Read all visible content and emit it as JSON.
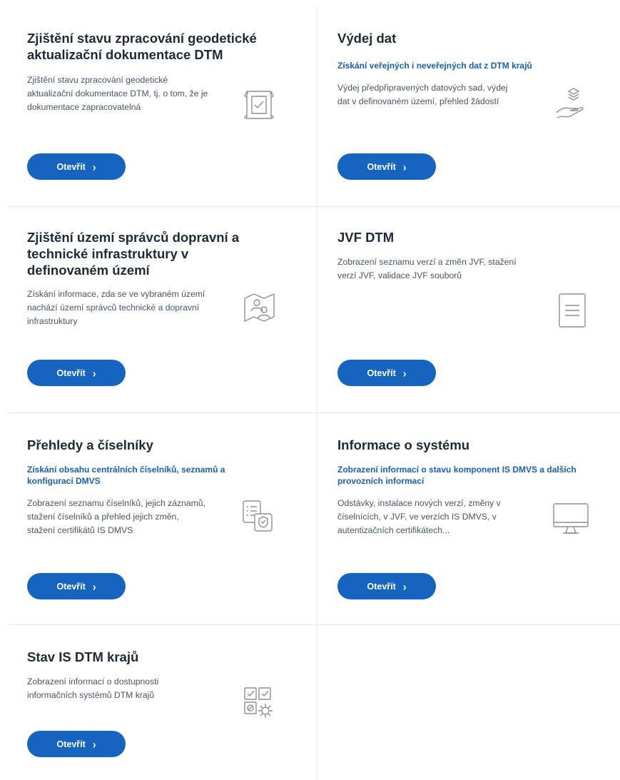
{
  "open_label": "Otevřít",
  "chevron": "›",
  "cards": [
    {
      "title": "Zjištění stavu zpracování geodetické aktualizační dokumentace DTM",
      "subtitle": "",
      "description": "Zjištění stavu zpracování geodetické aktualizační dokumentace DTM, tj. o tom, že je dokumentace zapracovatelná",
      "icon": "document-check-icon"
    },
    {
      "title": "Výdej dat",
      "subtitle": "Získání veřejných i neveřejných dat z DTM krajů",
      "description": "Výdej předpřipravených datových sad, výdej dat v definovaném území, přehled žádostí",
      "icon": "hand-layers-icon"
    },
    {
      "title": "Zjištění území správců dopravní a technické infrastruktury v definovaném území",
      "subtitle": "",
      "description": "Získání informace, zda se ve vybraném území nachází území správců technické a dopravní infrastruktury",
      "icon": "map-people-icon"
    },
    {
      "title": "JVF DTM",
      "subtitle": "",
      "description": "Zobrazení seznamu verzí a změn JVF, stažení verzí JVF, validace JVF souborů",
      "icon": "file-lines-icon"
    },
    {
      "title": "Přehledy a číselníky",
      "subtitle": "Získání obsahu centrálních číselníků, seznamů a konfigurací DMVS",
      "description": "Zobrazení seznamu číselníků, jejich záznamů, stažení číselníků a přehled jejich změn, stažení certifikátů IS DMVS",
      "icon": "list-certificate-icon"
    },
    {
      "title": "Informace o systému",
      "subtitle": "Zobrazení informací o stavu komponent IS DMVS a dalších provozních informací",
      "description": "Odstávky, instalace nových verzí, změny v číselnících, v JVF, ve verzích IS DMVS, v autentizačních certifikátech...",
      "icon": "monitor-icon"
    },
    {
      "title": "Stav IS DTM krajů",
      "subtitle": "",
      "description": "Zobrazení informací o dostupnosti informačních systémů DTM krajů",
      "icon": "checklist-gear-icon"
    }
  ]
}
